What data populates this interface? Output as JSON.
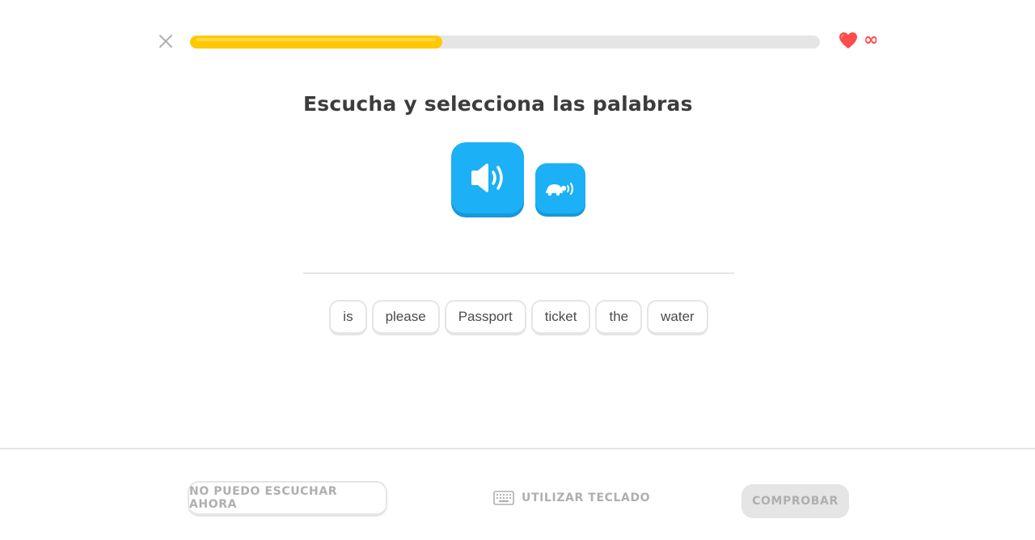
{
  "progress": {
    "value": 0.4
  },
  "lives": {
    "count_label": "∞",
    "color": "#ff4b4b"
  },
  "challenge": {
    "title": "Escucha y selecciona las palabras"
  },
  "audio": {
    "play_icon": "speaker-icon",
    "slow_icon": "turtle-icon"
  },
  "word_bank": {
    "words": [
      "is",
      "please",
      "Passport",
      "ticket",
      "the",
      "water"
    ]
  },
  "footer": {
    "cant_listen_label": "NO PUEDO ESCUCHAR AHORA",
    "keyboard_label": "UTILIZAR TECLADO",
    "check_label": "COMPROBAR"
  },
  "colors": {
    "accent_blue": "#1cb0f6",
    "progress_yellow": "#ffc800",
    "heart_red": "#ff4b4b"
  }
}
